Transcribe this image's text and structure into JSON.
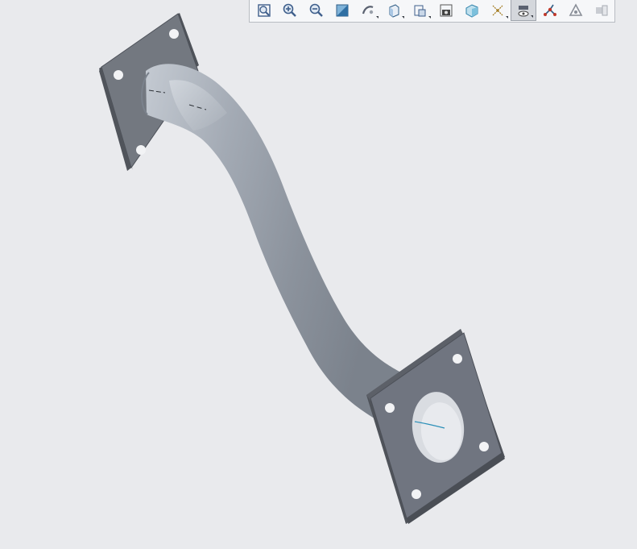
{
  "app": {
    "type": "3D CAD graphics window",
    "background_color": "#e9eaed"
  },
  "model": {
    "description_hidden": "",
    "body_color": "#9aa1ab",
    "flange_color": "#6f747c",
    "flange_edge_color": "#4c5058"
  },
  "toolbar": {
    "buttons": [
      {
        "id": "refit",
        "icon": "zoom-fit-icon",
        "active": false,
        "has_dropdown": false
      },
      {
        "id": "zoom-in",
        "icon": "zoom-in-icon",
        "active": false,
        "has_dropdown": false
      },
      {
        "id": "zoom-out",
        "icon": "zoom-out-icon",
        "active": false,
        "has_dropdown": false
      },
      {
        "id": "repaint",
        "icon": "repaint-icon",
        "active": false,
        "has_dropdown": false
      },
      {
        "id": "spin-center",
        "icon": "spin-center-icon",
        "active": false,
        "has_dropdown": true
      },
      {
        "id": "display-style",
        "icon": "display-style-icon",
        "active": false,
        "has_dropdown": true
      },
      {
        "id": "saved-orientations",
        "icon": "saved-orientations-icon",
        "active": false,
        "has_dropdown": true
      },
      {
        "id": "view-manager",
        "icon": "view-manager-icon",
        "active": false,
        "has_dropdown": false
      },
      {
        "id": "perspective",
        "icon": "perspective-view-icon",
        "active": false,
        "has_dropdown": false
      },
      {
        "id": "datum-display",
        "icon": "datum-display-filters-icon",
        "active": false,
        "has_dropdown": true
      },
      {
        "id": "annotation-display",
        "icon": "annotation-display-icon",
        "active": true,
        "has_dropdown": true
      },
      {
        "id": "points-display",
        "icon": "points-display-icon",
        "active": false,
        "has_dropdown": false
      },
      {
        "id": "simplified-rep",
        "icon": "simplified-rep-icon",
        "active": false,
        "has_dropdown": false
      },
      {
        "id": "appearance",
        "icon": "appearance-icon",
        "active": false,
        "has_dropdown": false
      }
    ]
  }
}
